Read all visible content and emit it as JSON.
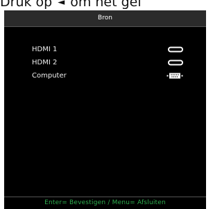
{
  "instruction": {
    "text_before": "Druk op",
    "arrow_icon": "left-arrow-icon",
    "text_after": "om het gel"
  },
  "osd": {
    "title": "Bron",
    "sources": [
      {
        "label": "HDMI 1",
        "icon": "hdmi-port-icon"
      },
      {
        "label": "HDMI 2",
        "icon": "hdmi-port-icon"
      },
      {
        "label": "Computer",
        "icon": "vga-port-icon"
      }
    ],
    "footer": "Enter= Bevestigen / Menu= Afsluiten"
  },
  "colors": {
    "osd_background": "#000000",
    "header_background": "#2b2b2b",
    "footer_text": "#2fae4f",
    "item_text": "#f0f0f0"
  }
}
